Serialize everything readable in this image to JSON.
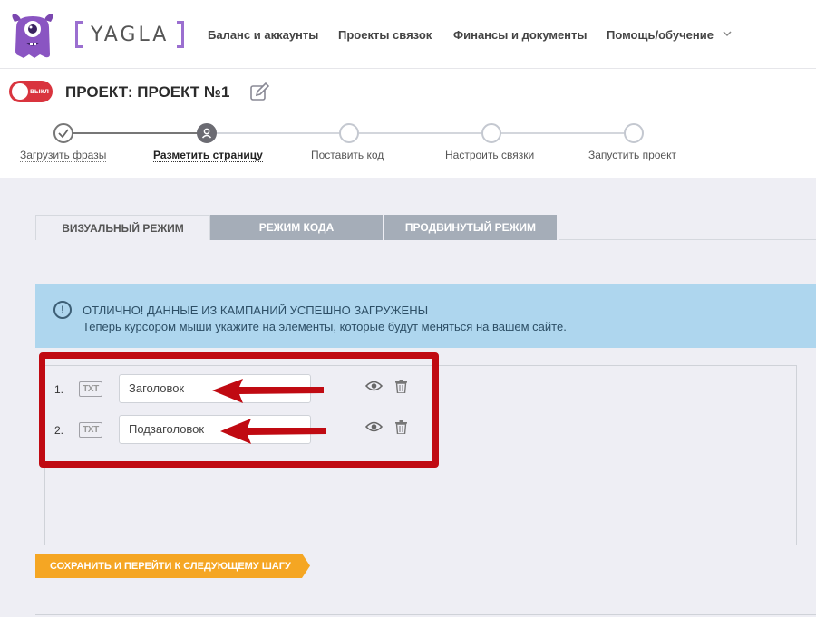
{
  "header": {
    "logo_text": "YAGLA",
    "nav": [
      {
        "label": "Баланс и аккаунты"
      },
      {
        "label": "Проекты связок"
      },
      {
        "label": "Финансы и документы"
      },
      {
        "label": "Помощь/обучение"
      }
    ]
  },
  "project": {
    "toggle_label": "выкл",
    "title": "ПРОЕКТ: ПРОЕКТ №1"
  },
  "steps": [
    {
      "label": "Загрузить фразы",
      "state": "done"
    },
    {
      "label": "Разметить страницу",
      "state": "active"
    },
    {
      "label": "Поставить код",
      "state": "pending"
    },
    {
      "label": "Настроить связки",
      "state": "pending"
    },
    {
      "label": "Запустить проект",
      "state": "pending"
    }
  ],
  "tabs": [
    {
      "label": "ВИЗУАЛЬНЫЙ РЕЖИМ",
      "active": true
    },
    {
      "label": "РЕЖИМ КОДА",
      "active": false
    },
    {
      "label": "ПРОДВИНУТЫЙ РЕЖИМ",
      "active": false
    }
  ],
  "info": {
    "icon": "!",
    "title": "ОТЛИЧНО! ДАННЫЕ ИЗ КАМПАНИЙ УСПЕШНО ЗАГРУЖЕНЫ",
    "text": "Теперь курсором мыши укажите на элементы, которые будут меняться на вашем сайте."
  },
  "elements": [
    {
      "num": "1.",
      "type": "TXT",
      "value": "Заголовок"
    },
    {
      "num": "2.",
      "type": "TXT",
      "value": "Подзаголовок"
    }
  ],
  "save_button": "СОХРАНИТЬ И ПЕРЕЙТИ К СЛЕДУЮЩЕМУ ШАГУ",
  "colors": {
    "accent_purple": "#9b6fd0",
    "toggle_red": "#d9343e",
    "info_bg": "#aed6ee",
    "highlight_red": "#c00a12",
    "button_orange": "#f5a623"
  }
}
